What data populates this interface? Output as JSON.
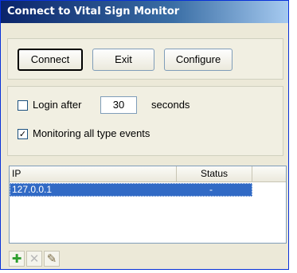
{
  "window": {
    "title": "Connect to Vital Sign Monitor"
  },
  "toolbar": {
    "connect_label": "Connect",
    "exit_label": "Exit",
    "configure_label": "Configure"
  },
  "options": {
    "login_label": "Login after",
    "login_value": "30",
    "seconds_label": "seconds",
    "monitoring_label": "Monitoring all type events",
    "login_checked": false,
    "monitoring_checked": true
  },
  "table": {
    "columns": [
      "IP",
      "Status"
    ],
    "rows": [
      {
        "ip": "127.0.0.1",
        "status": "-"
      }
    ]
  },
  "list_actions": {
    "add_icon": "plus-icon",
    "remove_icon": "x-icon",
    "edit_icon": "pencil-icon"
  },
  "colors": {
    "selection": "#316ac5",
    "add": "#2e9e2e"
  }
}
